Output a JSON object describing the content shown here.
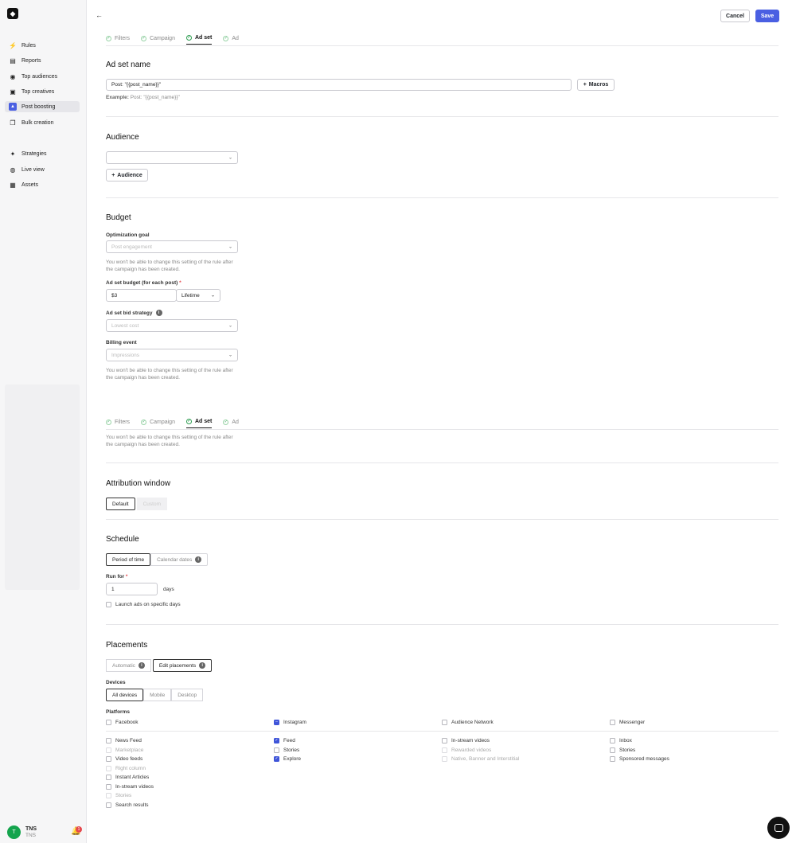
{
  "sidebar": {
    "logo": "◆",
    "items": [
      {
        "label": "Rules",
        "icon": "bolt-icon",
        "glyph": "⚡"
      },
      {
        "label": "Reports",
        "icon": "chart-icon",
        "glyph": "▤"
      },
      {
        "label": "Top audiences",
        "icon": "person-icon",
        "glyph": "◉"
      },
      {
        "label": "Top creatives",
        "icon": "image-icon",
        "glyph": "▣"
      },
      {
        "label": "Post boosting",
        "icon": "post-icon",
        "glyph": "▲"
      },
      {
        "label": "Bulk creation",
        "icon": "copy-icon",
        "glyph": "❐"
      },
      {
        "label": "Strategies",
        "icon": "compass-icon",
        "glyph": "✦"
      },
      {
        "label": "Live view",
        "icon": "globe-icon",
        "glyph": "◍"
      },
      {
        "label": "Assets",
        "icon": "grid-icon",
        "glyph": "▦"
      }
    ],
    "user": {
      "initial": "T",
      "name": "TNS",
      "sub": "TNS",
      "notifications": "1"
    }
  },
  "header": {
    "cancel_label": "Cancel",
    "save_label": "Save"
  },
  "tabs": [
    "Filters",
    "Campaign",
    "Ad set",
    "Ad"
  ],
  "adset_name": {
    "title": "Ad set name",
    "value": "Post: \"{{post_name}}\"",
    "macros_label": "Macros",
    "example_label": "Example:",
    "example_value": "Post: \"{{post_name}}\""
  },
  "audience": {
    "title": "Audience",
    "select_value": "",
    "add_label": "Audience"
  },
  "budget": {
    "title": "Budget",
    "optimization_goal_label": "Optimization goal",
    "optimization_goal_value": "Post engagement",
    "note": "You won't be able to change this setting of the rule after the campaign has been created.",
    "budget_label": "Ad set budget (for each post)",
    "budget_value": "$3",
    "budget_type": "Lifetime",
    "bid_strategy_label": "Ad set bid strategy",
    "bid_strategy_value": "Lowest cost",
    "billing_label": "Billing event",
    "billing_value": "Impressions"
  },
  "attribution": {
    "title": "Attribution window",
    "options": [
      "Default",
      "Custom"
    ]
  },
  "schedule": {
    "title": "Schedule",
    "options": [
      "Period of time",
      "Calendar dates"
    ],
    "run_for_label": "Run for",
    "run_for_value": "1",
    "run_for_unit": "days",
    "specific_days_label": "Launch ads on specific days"
  },
  "placements": {
    "title": "Placements",
    "modes": [
      "Automatic",
      "Edit placements"
    ],
    "devices_label": "Devices",
    "devices": [
      "All devices",
      "Mobile",
      "Desktop"
    ],
    "platforms_label": "Platforms",
    "platforms": [
      "Facebook",
      "Instagram",
      "Audience Network",
      "Messenger"
    ],
    "facebook": [
      "News Feed",
      "Marketplace",
      "Video feeds",
      "Right column",
      "Instant Articles",
      "In-stream videos",
      "Stories",
      "Search results"
    ],
    "instagram": [
      "Feed",
      "Stories",
      "Explore"
    ],
    "audience_network": [
      "In-stream videos",
      "Rewarded videos",
      "Native, Banner and Interstitial"
    ],
    "messenger": [
      "Inbox",
      "Stories",
      "Sponsored messages"
    ]
  }
}
